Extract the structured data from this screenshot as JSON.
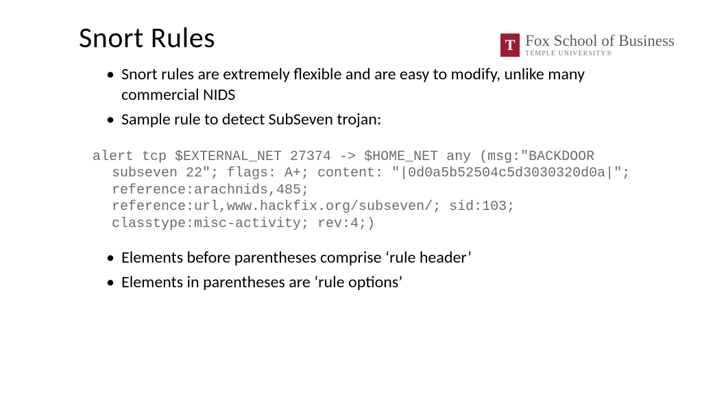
{
  "title": "Snort Rules",
  "logo": {
    "mark_letter": "T",
    "main": "Fox School of Business",
    "sub": "TEMPLE UNIVERSITY®"
  },
  "bullets_top": [
    "Snort rules are extremely flexible and are easy to modify, unlike many commercial NIDS",
    "Sample rule to detect SubSeven trojan:"
  ],
  "code": {
    "l1": "alert tcp $EXTERNAL_NET 27374 -> $HOME_NET any (msg:\"BACKDOOR",
    "l2": "subseven 22\"; flags: A+; content: \"|0d0a5b52504c5d3030320d0a|\";",
    "l3": "reference:arachnids,485;",
    "l4": "reference:url,www.hackfix.org/subseven/; sid:103;",
    "l5": "classtype:misc-activity; rev:4;)"
  },
  "bullets_bottom": [
    "Elements before parentheses comprise ‘rule header’",
    "Elements in parentheses are ‘rule options’"
  ]
}
